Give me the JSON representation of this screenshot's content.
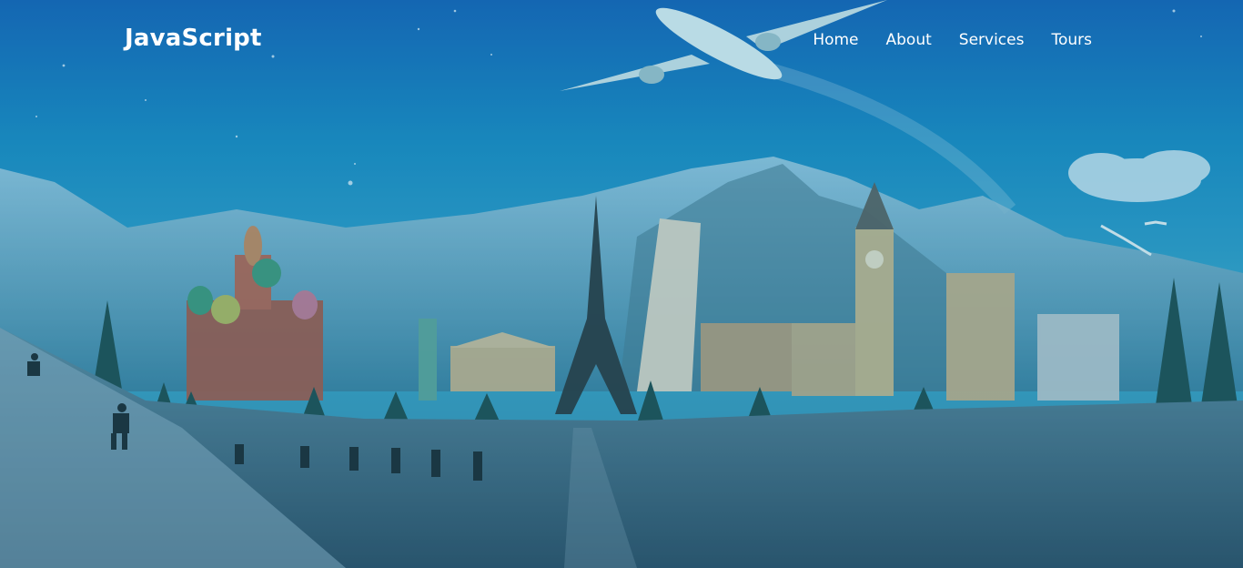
{
  "brand": {
    "logo_text": "JavaScript"
  },
  "nav": {
    "items": [
      {
        "label": "Home"
      },
      {
        "label": "About"
      },
      {
        "label": "Services"
      },
      {
        "label": "Tours"
      }
    ]
  },
  "hero": {
    "image": "world-landmarks-winter-travel-illustration",
    "overlay_color": "#0e6f9a",
    "sky_color": "#1a8dc4",
    "snow_color": "#46697c"
  }
}
